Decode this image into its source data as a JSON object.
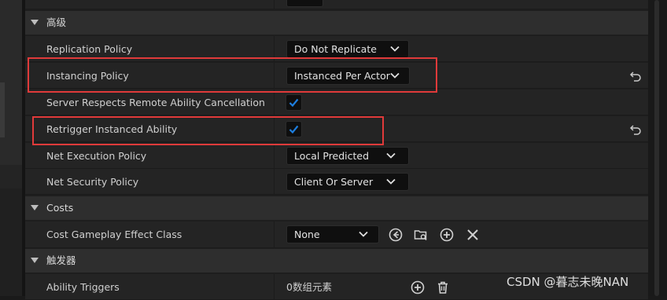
{
  "sections": {
    "advanced": {
      "title": "高级",
      "replication_policy": {
        "label": "Replication Policy",
        "value": "Do Not Replicate"
      },
      "instancing_policy": {
        "label": "Instancing Policy",
        "value": "Instanced Per Actor"
      },
      "server_respects_cancel": {
        "label": "Server Respects Remote Ability Cancellation",
        "checked": true
      },
      "retrigger_instanced": {
        "label": "Retrigger Instanced Ability",
        "checked": true
      },
      "net_execution_policy": {
        "label": "Net Execution Policy",
        "value": "Local Predicted"
      },
      "net_security_policy": {
        "label": "Net Security Policy",
        "value": "Client Or Server"
      }
    },
    "costs": {
      "title": "Costs",
      "cost_gameplay_effect": {
        "label": "Cost Gameplay Effect Class",
        "value": "None"
      }
    },
    "triggers": {
      "title": "触发器",
      "ability_triggers": {
        "label": "Ability Triggers",
        "value": "0数组元素"
      }
    }
  },
  "watermark": "CSDN @暮志未晚NAN",
  "colors": {
    "highlight": "#e03a3a",
    "checkbox_tick": "#1e7fe0",
    "panel": "#1e1e1e"
  }
}
